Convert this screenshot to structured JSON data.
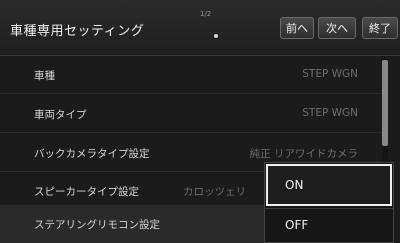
{
  "header": {
    "title": "車種専用セッティング",
    "page_indicator": "1/2",
    "buttons": {
      "prev": "前へ",
      "next": "次へ",
      "end": "終了"
    }
  },
  "settings": [
    {
      "label": "車種",
      "value": "STEP WGN"
    },
    {
      "label": "車両タイプ",
      "value": "STEP WGN"
    },
    {
      "label": "バックカメラタイプ設定",
      "value": "純正 リアワイドカメラ"
    },
    {
      "label": "スピーカータイプ設定",
      "value": "カロッツェリ"
    },
    {
      "label": "ステアリングリモコン設定",
      "value": ""
    }
  ],
  "dropdown": {
    "options": [
      "ON",
      "OFF"
    ],
    "selected": "ON"
  },
  "colors": {
    "background": "#1b1b1b",
    "highlight_border": "#f0f0f0"
  }
}
